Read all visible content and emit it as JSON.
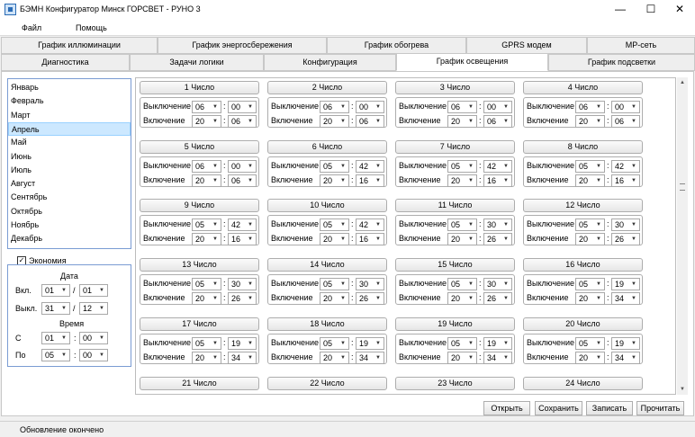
{
  "window": {
    "title": "БЭМН Конфигуратор Минск ГОРСВЕТ - РУНО 3",
    "minimize": "—",
    "maximize": "☐",
    "close": "✕"
  },
  "menu": [
    "Файл",
    "Помощь"
  ],
  "tabs_top": [
    "График иллюминации",
    "График энергосбережения",
    "График обогрева",
    "GPRS модем",
    "MP-сеть"
  ],
  "tabs_bottom": [
    "Диагностика",
    "Задачи логики",
    "Конфигурация",
    "График освещения",
    "График подсветки"
  ],
  "active_tab": "График освещения",
  "months": [
    "Январь",
    "Февраль",
    "Март",
    "Апрель",
    "Май",
    "Июнь",
    "Июль",
    "Август",
    "Сентябрь",
    "Октябрь",
    "Ноябрь",
    "Декабрь"
  ],
  "selected_month": "Апрель",
  "economy": {
    "label": "Экономия",
    "checked": true,
    "check_mark": "✓",
    "date_title": "Дата",
    "on_label": "Вкл.",
    "off_label": "Выкл.",
    "on_day": "01",
    "on_month": "01",
    "off_day": "31",
    "off_month": "12",
    "time_title": "Время",
    "from_label": "С",
    "to_label": "По",
    "from_h": "01",
    "from_m": "00",
    "to_h": "05",
    "to_m": "00",
    "slash": "/",
    "colon": ":"
  },
  "row_labels": {
    "off": "Выключение",
    "on": "Включение"
  },
  "days": [
    {
      "label": "1 Число",
      "off_h": "06",
      "off_m": "00",
      "on_h": "20",
      "on_m": "06"
    },
    {
      "label": "2 Число",
      "off_h": "06",
      "off_m": "00",
      "on_h": "20",
      "on_m": "06"
    },
    {
      "label": "3 Число",
      "off_h": "06",
      "off_m": "00",
      "on_h": "20",
      "on_m": "06"
    },
    {
      "label": "4 Число",
      "off_h": "06",
      "off_m": "00",
      "on_h": "20",
      "on_m": "06"
    },
    {
      "label": "5 Число",
      "off_h": "06",
      "off_m": "00",
      "on_h": "20",
      "on_m": "06"
    },
    {
      "label": "6 Число",
      "off_h": "05",
      "off_m": "42",
      "on_h": "20",
      "on_m": "16"
    },
    {
      "label": "7 Число",
      "off_h": "05",
      "off_m": "42",
      "on_h": "20",
      "on_m": "16"
    },
    {
      "label": "8 Число",
      "off_h": "05",
      "off_m": "42",
      "on_h": "20",
      "on_m": "16"
    },
    {
      "label": "9 Число",
      "off_h": "05",
      "off_m": "42",
      "on_h": "20",
      "on_m": "16"
    },
    {
      "label": "10 Число",
      "off_h": "05",
      "off_m": "42",
      "on_h": "20",
      "on_m": "16"
    },
    {
      "label": "11 Число",
      "off_h": "05",
      "off_m": "30",
      "on_h": "20",
      "on_m": "26"
    },
    {
      "label": "12 Число",
      "off_h": "05",
      "off_m": "30",
      "on_h": "20",
      "on_m": "26"
    },
    {
      "label": "13 Число",
      "off_h": "05",
      "off_m": "30",
      "on_h": "20",
      "on_m": "26"
    },
    {
      "label": "14 Число",
      "off_h": "05",
      "off_m": "30",
      "on_h": "20",
      "on_m": "26"
    },
    {
      "label": "15 Число",
      "off_h": "05",
      "off_m": "30",
      "on_h": "20",
      "on_m": "26"
    },
    {
      "label": "16 Число",
      "off_h": "05",
      "off_m": "19",
      "on_h": "20",
      "on_m": "34"
    },
    {
      "label": "17 Число",
      "off_h": "05",
      "off_m": "19",
      "on_h": "20",
      "on_m": "34"
    },
    {
      "label": "18 Число",
      "off_h": "05",
      "off_m": "19",
      "on_h": "20",
      "on_m": "34"
    },
    {
      "label": "19 Число",
      "off_h": "05",
      "off_m": "19",
      "on_h": "20",
      "on_m": "34"
    },
    {
      "label": "20 Число",
      "off_h": "05",
      "off_m": "19",
      "on_h": "20",
      "on_m": "34"
    },
    {
      "label": "21 Число"
    },
    {
      "label": "22 Число"
    },
    {
      "label": "23 Число"
    },
    {
      "label": "24 Число"
    }
  ],
  "buttons": [
    "Открыть",
    "Сохранить",
    "Записать",
    "Прочитать"
  ],
  "status": "Обновление окончено",
  "icons": {
    "dropdown": "chevron-down-icon",
    "scroll_up": "arrow-up-icon",
    "scroll_down": "arrow-down-icon",
    "app": "app-icon"
  }
}
